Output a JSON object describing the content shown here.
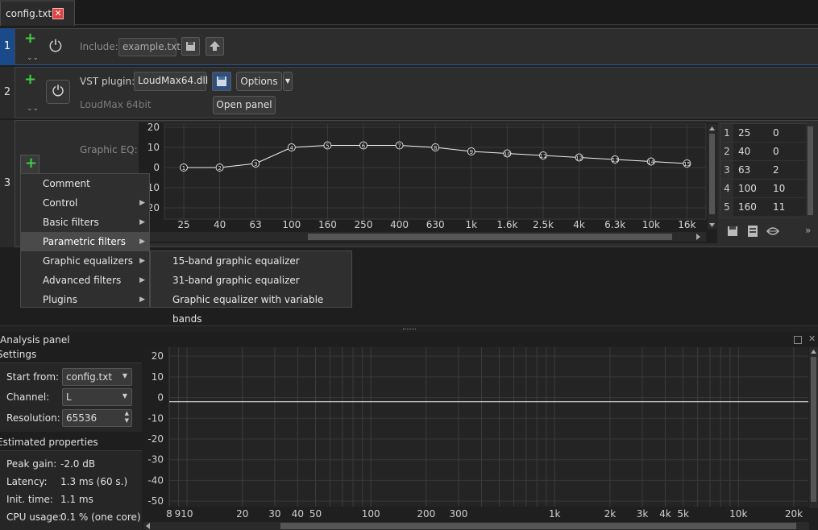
{
  "tab": {
    "title": "config.txt",
    "close": "✕"
  },
  "row1": {
    "num": "1",
    "include_label": "Include:",
    "include_value": "example.txt"
  },
  "row2": {
    "num": "2",
    "vst_label": "VST plugin:",
    "vst_value": "LoudMax64.dll",
    "options_label": "Options",
    "plugin_name": "LoudMax 64bit",
    "open_panel_label": "Open panel"
  },
  "row3": {
    "num": "3",
    "geq_label": "Graphic EQ:"
  },
  "geq": {
    "y_ticks": [
      "20",
      "10",
      "0",
      "10",
      "20"
    ],
    "x_ticks": [
      "25",
      "40",
      "63",
      "100",
      "160",
      "250",
      "400",
      "630",
      "1k",
      "1.6k",
      "2.5k",
      "4k",
      "6.3k",
      "10k",
      "16k"
    ],
    "points": [
      {
        "band": "1",
        "freq": 25,
        "gain": 0
      },
      {
        "band": "2",
        "freq": 40,
        "gain": 0
      },
      {
        "band": "3",
        "freq": 63,
        "gain": 2
      },
      {
        "band": "4",
        "freq": 100,
        "gain": 10
      },
      {
        "band": "5",
        "freq": 160,
        "gain": 11
      },
      {
        "band": "6",
        "freq": 250,
        "gain": 11
      },
      {
        "band": "7",
        "freq": 400,
        "gain": 11
      },
      {
        "band": "8",
        "freq": 630,
        "gain": 10
      },
      {
        "band": "9",
        "freq": 1000,
        "gain": 8
      },
      {
        "band": "10",
        "freq": 1600,
        "gain": 7
      },
      {
        "band": "11",
        "freq": 2500,
        "gain": 6
      },
      {
        "band": "12",
        "freq": 4000,
        "gain": 5
      },
      {
        "band": "13",
        "freq": 6300,
        "gain": 4
      },
      {
        "band": "14",
        "freq": 10000,
        "gain": 3
      },
      {
        "band": "15",
        "freq": 16000,
        "gain": 2
      }
    ],
    "table": [
      {
        "n": "1",
        "freq": "25",
        "gain": "0"
      },
      {
        "n": "2",
        "freq": "40",
        "gain": "0"
      },
      {
        "n": "3",
        "freq": "63",
        "gain": "2"
      },
      {
        "n": "4",
        "freq": "100",
        "gain": "10"
      },
      {
        "n": "5",
        "freq": "160",
        "gain": "11"
      }
    ],
    "more": "»"
  },
  "menu": {
    "items": [
      "Comment",
      "Control",
      "Basic filters",
      "Parametric filters",
      "Graphic equalizers",
      "Advanced filters",
      "Plugins"
    ],
    "submenu": [
      "15-band graphic equalizer",
      "31-band graphic equalizer",
      "Graphic equalizer with variable bands"
    ]
  },
  "analysis": {
    "title": "Analysis panel",
    "settings": "Settings",
    "start_from_label": "Start from:",
    "start_from_value": "config.txt",
    "channel_label": "Channel:",
    "channel_value": "L",
    "resolution_label": "Resolution:",
    "resolution_value": "65536",
    "est_title": "Estimated properties",
    "props": [
      {
        "k": "Peak gain:",
        "v": "-2.0 dB"
      },
      {
        "k": "Latency:",
        "v": "1.3 ms (60 s.)"
      },
      {
        "k": "Init. time:",
        "v": "1.1 ms"
      },
      {
        "k": "CPU usage:",
        "v": "0.1 % (one core)"
      }
    ]
  },
  "chart_data": {
    "type": "line",
    "ylim": [
      -55,
      22
    ],
    "y_ticks": [
      "20",
      "10",
      "0",
      "-10",
      "-20",
      "-30",
      "-40",
      "-50"
    ],
    "x_ticks": [
      "8",
      "910",
      "20",
      "30",
      "40",
      "50",
      "100",
      "200",
      "300",
      "1k",
      "2k",
      "3k",
      "4k",
      "5k",
      "10k",
      "20k"
    ],
    "xlim": [
      8,
      24000
    ],
    "series": [
      {
        "values": [
          {
            "x": 8,
            "y": -2
          },
          {
            "x": 24000,
            "y": -2
          }
        ]
      }
    ]
  }
}
